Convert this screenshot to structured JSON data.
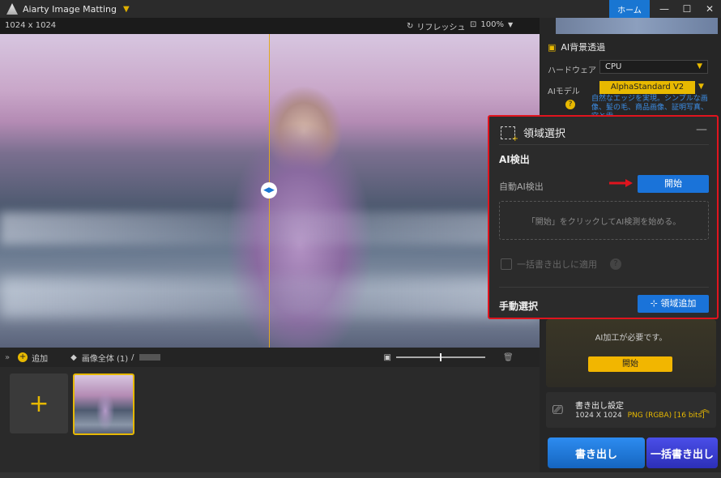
{
  "window": {
    "title": "Aiarty Image Matting",
    "home_label": "ホーム"
  },
  "toolbar": {
    "dimensions": "1024 x 1024",
    "refresh_label": "リフレッシュ",
    "zoom": "100%"
  },
  "bottombar": {
    "add_label": "追加",
    "path_label": "画像全体 (1)",
    "path_sep": "/"
  },
  "right": {
    "section_title": "AI背景透過",
    "hardware_label": "ハードウェア",
    "hardware_value": "CPU",
    "model_label": "AIモデル",
    "model_value": "AlphaStandard  V2",
    "model_desc": "自然なエッジを実現。シンプルな画像、髪の毛、商品画像、証明写真、空と雲、",
    "ai_needed": "AI加工が必要です。",
    "ai_start": "開始",
    "export_title": "書き出し設定",
    "export_size": "1024 X 1024",
    "export_format": "PNG (RGBA) [16 bits]",
    "export_button": "書き出し",
    "batch_export_button": "一括書き出し"
  },
  "popup": {
    "title": "領域選択",
    "minimize": "—",
    "ai_detect": "AI検出",
    "auto_label": "自動AI検出",
    "start": "開始",
    "hint": "「開始」をクリックしてAI検測を始める。",
    "batch_apply": "一括書き出しに適用",
    "manual": "手動選択",
    "add_region": "領域追加"
  },
  "colors": {
    "accent_blue": "#1a73d9",
    "accent_yellow": "#e8b900",
    "highlight_red": "#e0141e"
  }
}
